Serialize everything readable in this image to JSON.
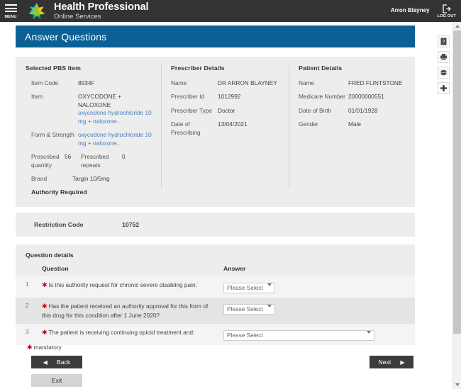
{
  "header": {
    "menu_label": "MENU",
    "brand_title": "Health Professional",
    "brand_subtitle": "Online Services",
    "user_name": "Arron Blayney",
    "logout_label": "LOG OUT",
    "menu_icon": "hamburger-menu-icon",
    "logo_icon": "services-australia-star-logo",
    "logout_icon": "logout-arrow-icon"
  },
  "page": {
    "title": "Answer Questions",
    "title_bar_color": "#0b6196"
  },
  "pbs_item": {
    "heading": "Selected PBS Item",
    "fields": [
      {
        "label": "Item Code",
        "value": "8934F"
      }
    ],
    "item_label": "Item",
    "item_value_line1": "OXYCODONE +",
    "item_value_line2": "NALOXONE",
    "item_link_text": "oxycodone hydrochloride 10 mg + naloxone...",
    "form_label": "Form & Strength",
    "form_link_text": "oxycodone hydrochloride 10 mg + naloxone...",
    "qty_label": "Prescribed quantity",
    "qty_value": "56",
    "repeats_label": "Prescribed repeats",
    "repeats_value": "0",
    "brand_label": "Brand",
    "brand_value": "Targin 10/5mg",
    "authority_required": "Authority Required"
  },
  "prescriber": {
    "heading": "Prescriber Details",
    "fields": [
      {
        "label": "Name",
        "value": "DR ARRON BLAYNEY"
      },
      {
        "label": "Prescriber Id",
        "value": "1012992"
      },
      {
        "label": "Prescriber Type",
        "value": "Doctor"
      },
      {
        "label": "Date of Prescribing",
        "value": "13/04/2021"
      }
    ]
  },
  "patient": {
    "heading": "Patient Details",
    "fields": [
      {
        "label": "Name",
        "value": "FRED FLINTSTONE"
      },
      {
        "label": "Medicare Number",
        "value": "20000000551"
      },
      {
        "label": "Date of Birth",
        "value": "01/01/1928"
      },
      {
        "label": "Gender",
        "value": "Male"
      }
    ]
  },
  "restriction": {
    "label": "Restriction Code",
    "value": "10752"
  },
  "questions": {
    "section_title": "Question details",
    "col_question": "Question",
    "col_answer": "Answer",
    "rows": [
      {
        "num": "1",
        "text": "Is this authority request for chronic severe disabling pain:",
        "answer_value": "Please Select",
        "mandatory": true
      },
      {
        "num": "2",
        "text": "Has the patient received an authority approval for this form of this drug for this condition after 1 June 2020?",
        "answer_value": "Please Select",
        "mandatory": true
      },
      {
        "num": "3",
        "text": "The patient is receiving continuing opioid treatment and:",
        "answer_value": "Please Select",
        "mandatory": true
      }
    ]
  },
  "footer": {
    "mandatory_note": "mandatory",
    "back_label": "Back",
    "next_label": "Next",
    "exit_label": "Exit",
    "back_arrow": "◀",
    "next_arrow": "▶"
  },
  "tool_rail": {
    "items": [
      {
        "icon": "help-question-icon"
      },
      {
        "icon": "print-icon"
      },
      {
        "icon": "globe-icon"
      },
      {
        "icon": "plus-zoom-icon"
      }
    ]
  },
  "colors": {
    "header_bg": "#333333",
    "panel_bg": "#ededed",
    "accent_blue": "#0b6196",
    "link_blue": "#4a7ebb",
    "required_red": "#d0021b",
    "button_dark": "#3c3c3c"
  }
}
